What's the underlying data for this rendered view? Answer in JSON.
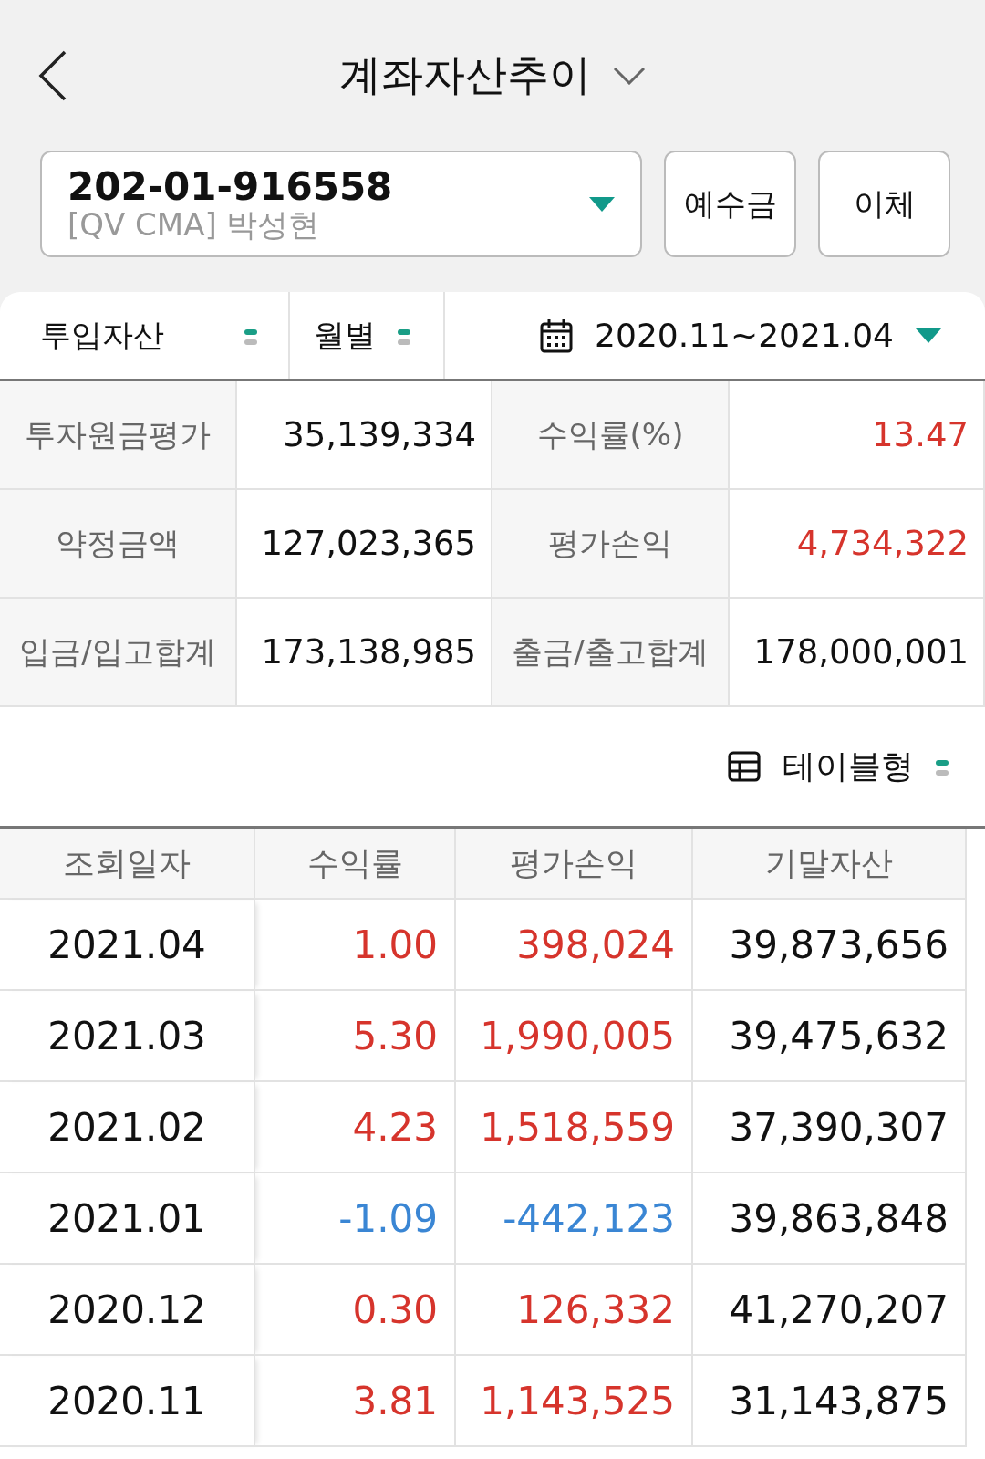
{
  "header": {
    "title": "계좌자산추이"
  },
  "account": {
    "number": "202-01-916558",
    "name": "[QV CMA] 박성현"
  },
  "buttons": [
    "예수금",
    "이체"
  ],
  "filters": {
    "asset_type": "투입자산",
    "period_type": "월별",
    "date_range": "2020.11~2021.04"
  },
  "summary": [
    {
      "label": "투자원금평가",
      "value": "35,139,334",
      "color": "#111111"
    },
    {
      "label": "수익률(%)",
      "value": "13.47",
      "color": "#d6342c"
    },
    {
      "label": "약정금액",
      "value": "127,023,365",
      "color": "#111111"
    },
    {
      "label": "평가손익",
      "value": "4,734,322",
      "color": "#d6342c"
    },
    {
      "label": "입금/입고합계",
      "value": "173,138,985",
      "color": "#111111"
    },
    {
      "label": "출금/출고합계",
      "value": "178,000,001",
      "color": "#111111"
    }
  ],
  "view_toggle": {
    "label": "테이블형"
  },
  "table": {
    "columns": [
      "조회일자",
      "수익률",
      "평가손익",
      "기말자산"
    ],
    "rows": [
      {
        "date": "2021.04",
        "rate": "1.00",
        "profit": "398,024",
        "assets": "39,873,656",
        "color": "#d6342c"
      },
      {
        "date": "2021.03",
        "rate": "5.30",
        "profit": "1,990,005",
        "assets": "39,475,632",
        "color": "#d6342c"
      },
      {
        "date": "2021.02",
        "rate": "4.23",
        "profit": "1,518,559",
        "assets": "37,390,307",
        "color": "#d6342c"
      },
      {
        "date": "2021.01",
        "rate": "-1.09",
        "profit": "-442,123",
        "assets": "39,863,848",
        "color": "#3a86d4"
      },
      {
        "date": "2020.12",
        "rate": "0.30",
        "profit": "126,332",
        "assets": "41,270,207",
        "color": "#d6342c"
      },
      {
        "date": "2020.11",
        "rate": "3.81",
        "profit": "1,143,525",
        "assets": "31,143,875",
        "color": "#d6342c"
      }
    ]
  }
}
